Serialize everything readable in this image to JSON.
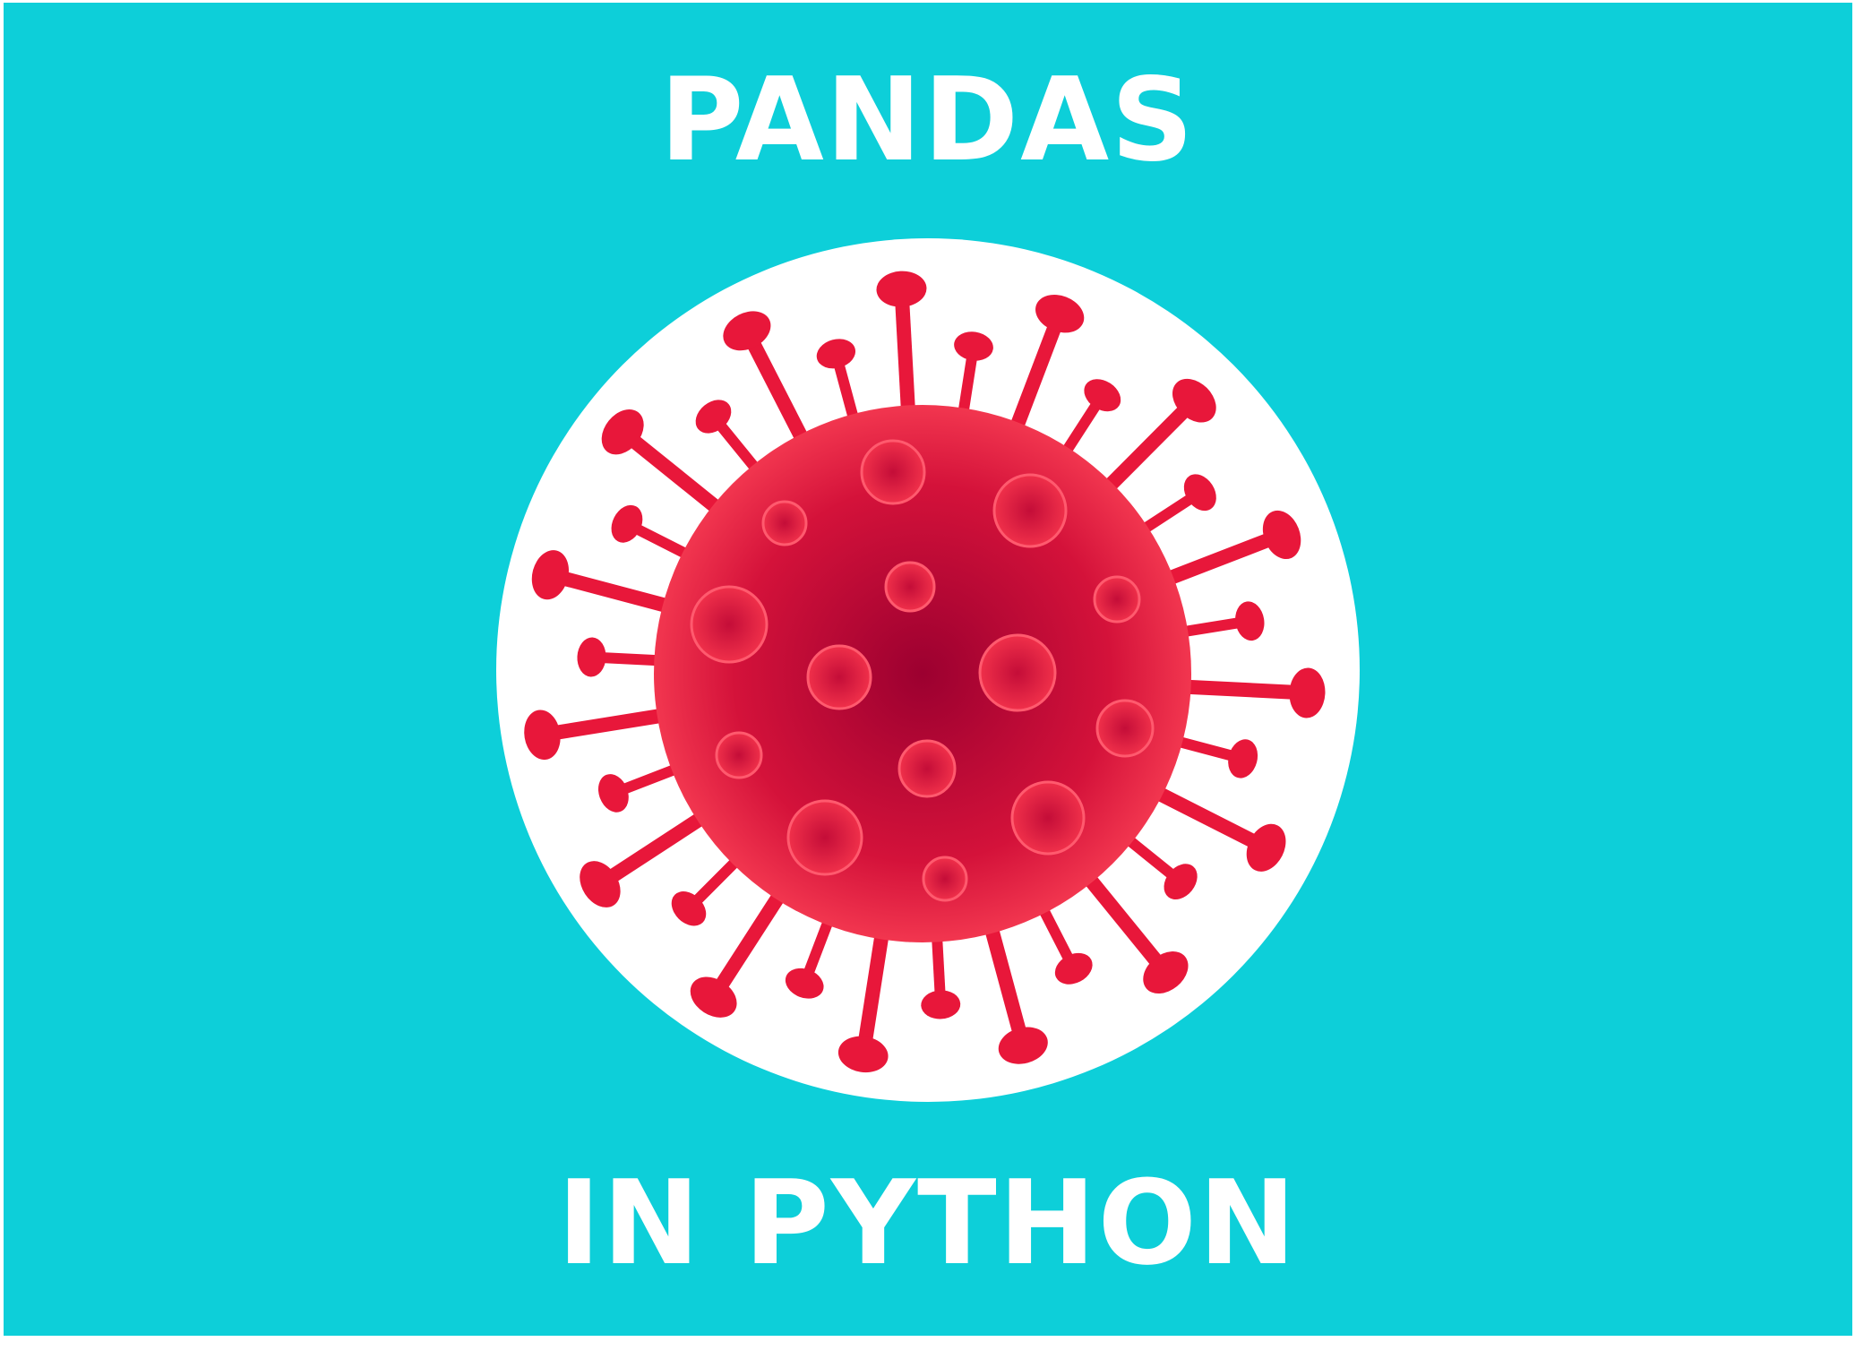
{
  "banner": {
    "title_top": "PANDAS",
    "title_bottom": "IN PYTHON",
    "background_color": "#0dcfd9",
    "text_color": "#ffffff",
    "virus_color": "#e8173a",
    "virus_dark_color": "#9c0030",
    "icon": "coronavirus-icon"
  }
}
